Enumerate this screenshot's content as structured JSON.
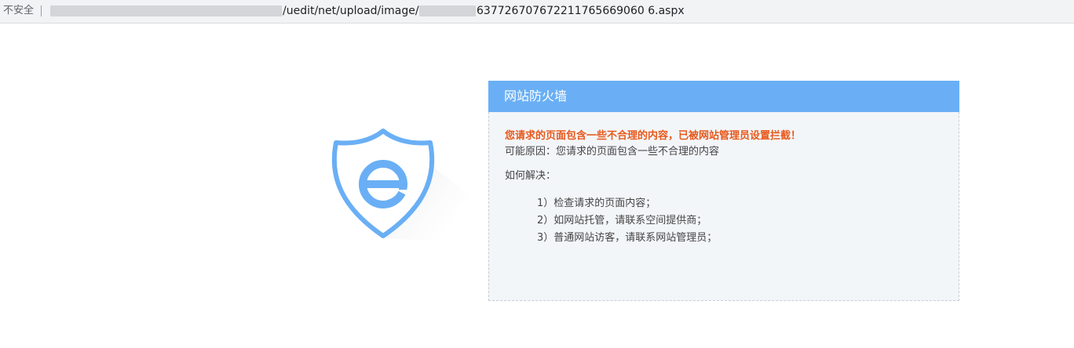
{
  "address_bar": {
    "security_label": "不安全",
    "url_visible_middle": "/uedit/net/upload/image/",
    "url_visible_tail": "637726707672211765669060 6.aspx"
  },
  "firewall": {
    "title": "网站防火墙",
    "warning": "您请求的页面包含一些不合理的内容，已被网站管理员设置拦截！",
    "reason": "可能原因：您请求的页面包含一些不合理的内容",
    "how_to_label": "如何解决：",
    "steps": [
      "1）检查请求的页面内容；",
      "2）如网站托管，请联系空间提供商；",
      "3）普通网站访客，请联系网站管理员；"
    ]
  },
  "logo_icon": "shield-e-icon",
  "colors": {
    "header_blue": "#6aaff5",
    "warning_orange": "#e8581c",
    "panel_bg": "#f3f6f9"
  }
}
